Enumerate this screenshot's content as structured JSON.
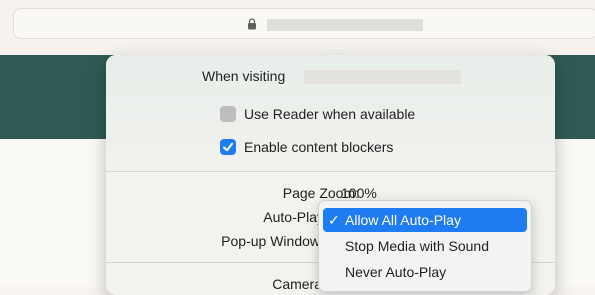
{
  "popover": {
    "visiting_label": "When visiting",
    "options": [
      {
        "label": "Use Reader when available",
        "checked": false
      },
      {
        "label": "Enable content blockers",
        "checked": true
      }
    ],
    "settings": {
      "page_zoom": {
        "label": "Page Zoom:",
        "value": "100%"
      },
      "auto_play": {
        "label": "Auto-Play"
      },
      "popup_windows": {
        "label": "Pop-up Window"
      },
      "camera": {
        "label": "Camera"
      }
    }
  },
  "autoplay_menu": {
    "items": [
      {
        "label": "Allow All Auto-Play",
        "selected": true
      },
      {
        "label": "Stop Media with Sound",
        "selected": false
      },
      {
        "label": "Never Auto-Play",
        "selected": false
      }
    ],
    "check_glyph": "✓"
  },
  "colors": {
    "accent": "#1f7bf2",
    "banner": "#2f5a53"
  },
  "icons": {
    "address_bar": "lock-icon",
    "checked": "checkmark-icon"
  }
}
